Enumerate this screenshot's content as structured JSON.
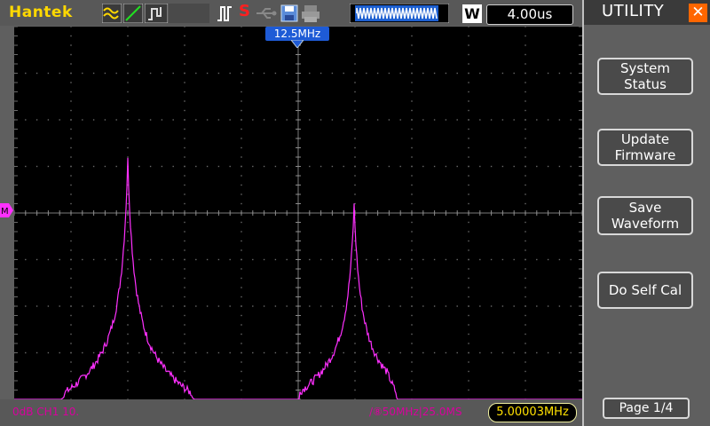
{
  "header": {
    "brand": "Hantek",
    "timebase": "4.00us",
    "mode_badge": "W",
    "cursor_label": "12.5MHz"
  },
  "icons": [
    "acquire-icon",
    "edge-icon",
    "runstop-icon",
    "pulse-icon",
    "stop-s-icon",
    "usb-icon",
    "save-icon",
    "print-icon",
    "memory-waveform-icon"
  ],
  "footer": {
    "channel_info": "0dB  CH1  10.",
    "fft_info": "/⑧50MHz|25.0MS",
    "frequency": "5.00003MHz"
  },
  "panel": {
    "title": "UTILITY",
    "buttons": [
      {
        "line1": "System",
        "line2": "Status"
      },
      {
        "line1": "Update",
        "line2": "Firmware"
      },
      {
        "line1": "Save",
        "line2": "Waveform"
      },
      {
        "line1": "Do Self Cal",
        "line2": ""
      }
    ],
    "page": "Page 1/4"
  },
  "colors": {
    "trace": "#ff30ff",
    "brand": "#ffd800",
    "accent": "#ff6600",
    "cursor": "#1e5bd6"
  }
}
